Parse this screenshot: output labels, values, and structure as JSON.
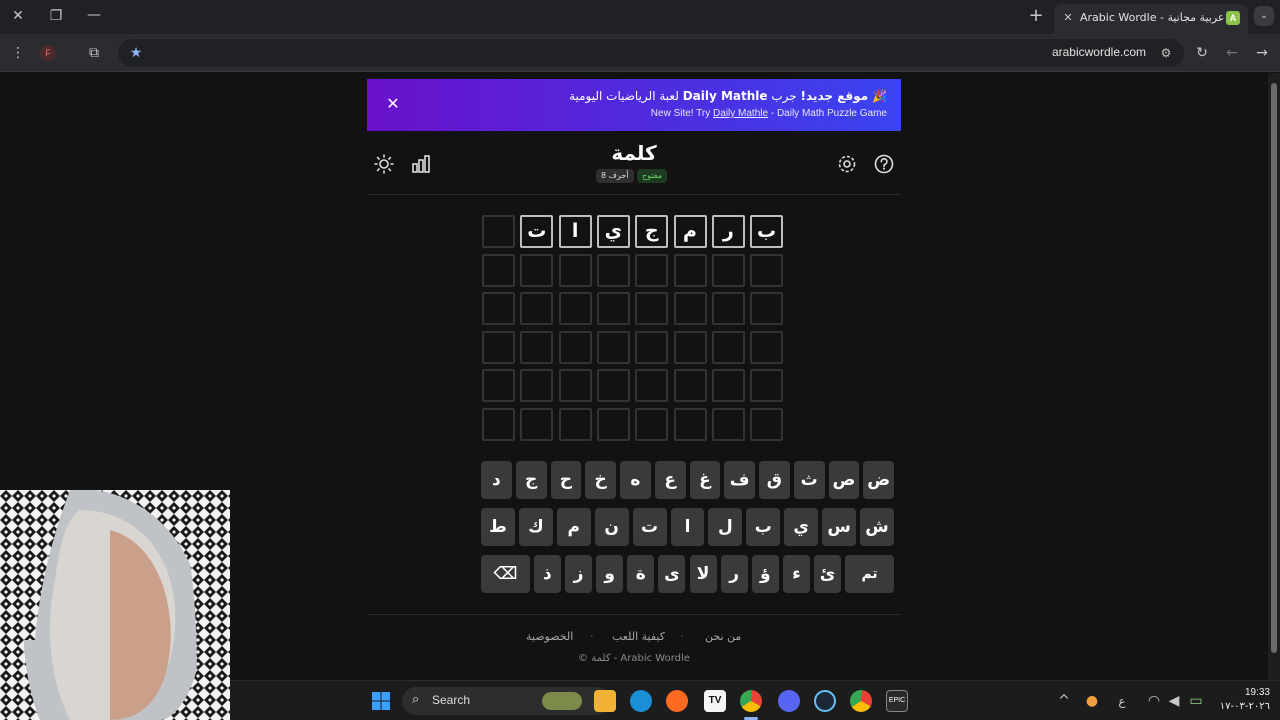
{
  "browser": {
    "tab_title": "Arabic Wordle - لعبة وردل عربية مجانية",
    "tab_favicon": "A",
    "profile_initial": "F",
    "url": "arabicwordle.com"
  },
  "banner": {
    "line1_bold": "موقع جديد!",
    "line1_mid": "جرب",
    "line1_link": "Daily Mathle",
    "line1_end": "لعبة الرياضيات اليومية",
    "line2_pre": "New Site! Try",
    "line2_link": "Daily Mathle",
    "line2_post": "- Daily Math Puzzle Game"
  },
  "header": {
    "title": "كلمة",
    "badge_open": "مفتوح",
    "badge_length": "8 أحرف"
  },
  "grid": {
    "rows": [
      [
        "ب",
        "ر",
        "م",
        "ج",
        "ي",
        "ا",
        "ت",
        ""
      ],
      [
        "",
        "",
        "",
        "",
        "",
        "",
        "",
        ""
      ],
      [
        "",
        "",
        "",
        "",
        "",
        "",
        "",
        ""
      ],
      [
        "",
        "",
        "",
        "",
        "",
        "",
        "",
        ""
      ],
      [
        "",
        "",
        "",
        "",
        "",
        "",
        "",
        ""
      ],
      [
        "",
        "",
        "",
        "",
        "",
        "",
        "",
        ""
      ]
    ]
  },
  "keyboard": {
    "row1": [
      "ض",
      "ص",
      "ث",
      "ق",
      "ف",
      "غ",
      "ع",
      "ه",
      "خ",
      "ح",
      "ج",
      "د"
    ],
    "row2": [
      "ش",
      "س",
      "ي",
      "ب",
      "ل",
      "ا",
      "ت",
      "ن",
      "م",
      "ك",
      "ط"
    ],
    "row3": [
      "تم",
      "ئ",
      "ء",
      "ؤ",
      "ر",
      "لا",
      "ى",
      "ة",
      "و",
      "ز",
      "ذ",
      "⌫"
    ]
  },
  "footer": {
    "about": "من نحن",
    "how_to_play": "كيفية اللعب",
    "privacy": "الخصوصية",
    "copyright": "© كلمة - Arabic Wordle"
  },
  "taskbar": {
    "search_label": "Search",
    "time": "19:33",
    "date": "٢٠٢٦-٠٣-١٧",
    "input_lang": "ع"
  },
  "colors": {
    "page_bg": "#121212",
    "key_bg": "#3a3a3c",
    "banner_start": "#6a11cb",
    "banner_end": "#3c44f0",
    "badge_open": "#6bd46f"
  }
}
